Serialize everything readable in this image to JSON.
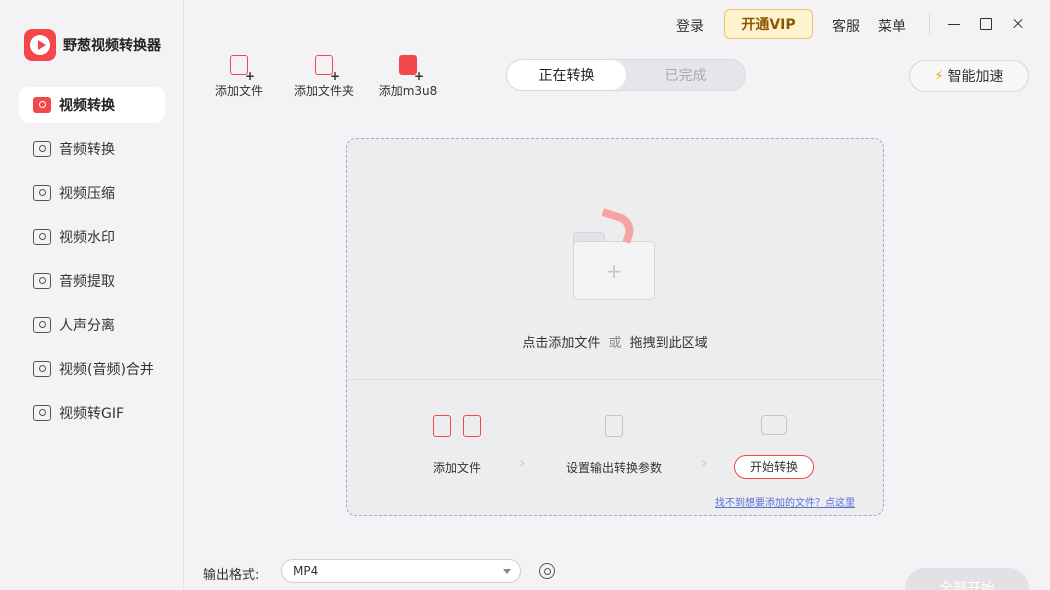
{
  "app": {
    "name": "野葱视频转换器"
  },
  "topbar": {
    "login": "登录",
    "vip": "开通VIP",
    "service": "客服",
    "menu": "菜单"
  },
  "sidebar": {
    "items": [
      {
        "label": "视频转换",
        "icon": "video-convert-icon",
        "active": true
      },
      {
        "label": "音频转换",
        "icon": "audio-convert-icon"
      },
      {
        "label": "视频压缩",
        "icon": "video-compress-icon"
      },
      {
        "label": "视频水印",
        "icon": "video-watermark-icon"
      },
      {
        "label": "音频提取",
        "icon": "audio-extract-icon"
      },
      {
        "label": "人声分离",
        "icon": "vocal-separate-icon"
      },
      {
        "label": "视频(音频)合并",
        "icon": "merge-icon"
      },
      {
        "label": "视频转GIF",
        "icon": "gif-icon"
      }
    ]
  },
  "toolbar": {
    "add_file": "添加文件",
    "add_folder": "添加文件夹",
    "add_m3u8": "添加m3u8"
  },
  "tabs": {
    "converting": "正在转换",
    "completed": "已完成"
  },
  "speed": {
    "label": "智能加速"
  },
  "dropzone": {
    "text_click": "点击添加文件",
    "text_or": "或",
    "text_drag": "拖拽到此区域",
    "step1": "添加文件",
    "step2": "设置输出转换参数",
    "step3": "开始转换",
    "help": "找不到想要添加的文件？点这里"
  },
  "output": {
    "label": "输出格式:",
    "format": "MP4"
  },
  "footer": {
    "start_all": "全部开始"
  },
  "colors": {
    "accent": "#f2484b",
    "vip_bg": "#fff3cf",
    "link": "#5b6fd6"
  }
}
